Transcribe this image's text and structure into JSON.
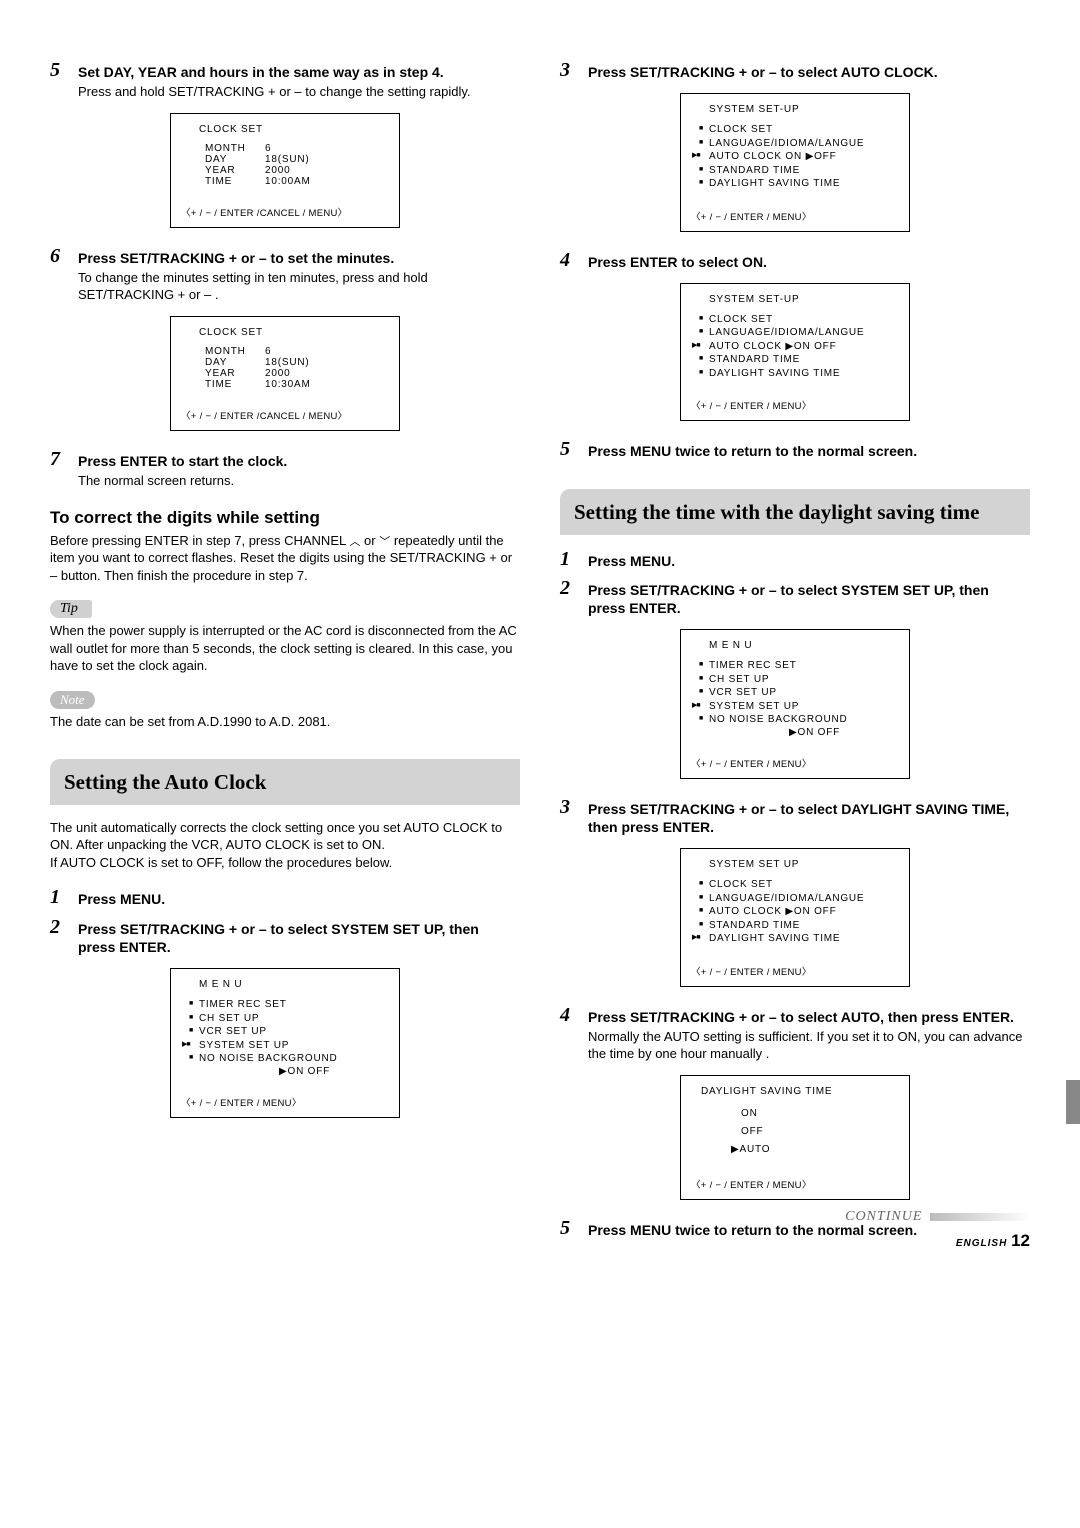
{
  "left": {
    "step5": {
      "title": "Set DAY, YEAR and hours in the same way as in step 4.",
      "text": "Press and hold SET/TRACKING + or – to change the setting rapidly."
    },
    "osd_clock1": {
      "title": "CLOCK  SET",
      "month_l": "MONTH",
      "month_v": "6",
      "day_l": "DAY",
      "day_v": "18(SUN)",
      "year_l": "YEAR",
      "year_v": "2000",
      "time_l": "TIME",
      "time_v": "10:00AM",
      "footer": "〈+ / − / ENTER /CANCEL / MENU〉"
    },
    "step6": {
      "title": "Press SET/TRACKING + or – to set the minutes.",
      "text": "To change the minutes setting in ten minutes, press and hold SET/TRACKING + or – ."
    },
    "osd_clock2": {
      "title": "CLOCK  SET",
      "month_l": "MONTH",
      "month_v": "6",
      "day_l": "DAY",
      "day_v": "18(SUN)",
      "year_l": "YEAR",
      "year_v": "2000",
      "time_l": "TIME",
      "time_v": "10:30AM",
      "footer": "〈+ / − / ENTER /CANCEL / MENU〉"
    },
    "step7": {
      "title": "Press ENTER to start the clock.",
      "text": "The normal screen returns."
    },
    "correct_heading": "To correct the digits while setting",
    "correct_text1": "Before pressing ENTER in step 7, press CHANNEL",
    "correct_text2": "or",
    "correct_text3": "repeatedly until the item you want to correct flashes. Reset the digits using the SET/TRACKING + or – button. Then finish the procedure in step 7.",
    "tip_label": "Tip",
    "tip_text": "When the power supply is interrupted or the AC cord is disconnected from the AC wall outlet for more than 5 seconds, the clock setting is cleared. In this case, you have to set the clock again.",
    "note_label": "Note",
    "note_text": "The date can be set from A.D.1990 to A.D. 2081.",
    "autoclock_heading": "Setting the Auto Clock",
    "autoclock_intro": "The unit automatically corrects the clock setting once you set AUTO CLOCK to ON. After unpacking the VCR, AUTO CLOCK is set to ON.\nIf AUTO CLOCK is set to OFF, follow the procedures below.",
    "ac_step1": "Press MENU.",
    "ac_step2": "Press SET/TRACKING + or – to select SYSTEM SET UP, then press ENTER.",
    "osd_menu1": {
      "title": "M  E  N  U",
      "i1": "TIMER REC SET",
      "i2": "CH SET UP",
      "i3": "VCR SET UP",
      "i4": "SYSTEM SET UP",
      "i5": "NO NOISE BACKGROUND",
      "onoff": "▶ON    OFF",
      "footer": "〈+ / − / ENTER / MENU〉"
    }
  },
  "right": {
    "step3": "Press SET/TRACKING + or – to select AUTO CLOCK.",
    "osd_sys1": {
      "title": "SYSTEM  SET-UP",
      "i1": "CLOCK SET",
      "i2": "LANGUAGE/IDIOMA/LANGUE",
      "i3": "AUTO CLOCK    ON   ▶OFF",
      "i4": "STANDARD TIME",
      "i5": "DAYLIGHT SAVING TIME",
      "footer": "〈+ / − / ENTER / MENU〉"
    },
    "step4": "Press ENTER to select ON.",
    "osd_sys2": {
      "title": "SYSTEM  SET-UP",
      "i1": "CLOCK SET",
      "i2": "LANGUAGE/IDIOMA/LANGUE",
      "i3": "AUTO CLOCK  ▶ON    OFF",
      "i4": "STANDARD TIME",
      "i5": "DAYLIGHT SAVING TIME",
      "footer": "〈+ / − / ENTER / MENU〉"
    },
    "step5": "Press MENU twice to return to the normal screen.",
    "dst_heading": "Setting the time with the daylight saving time",
    "d_step1": "Press MENU.",
    "d_step2": "Press SET/TRACKING + or – to select SYSTEM SET UP, then press ENTER.",
    "osd_menu2": {
      "title": "M  E  N  U",
      "i1": "TIMER REC SET",
      "i2": "CH SET UP",
      "i3": "VCR SET UP",
      "i4": "SYSTEM SET UP",
      "i5": "NO NOISE BACKGROUND",
      "onoff": "▶ON    OFF",
      "footer": "〈+ / − / ENTER / MENU〉"
    },
    "d_step3": "Press SET/TRACKING + or – to select DAYLIGHT SAVING TIME, then press ENTER.",
    "osd_sys3": {
      "title": "SYSTEM  SET UP",
      "i1": "CLOCK SET",
      "i2": "LANGUAGE/IDIOMA/LANGUE",
      "i3": "AUTO CLOCK  ▶ON    OFF",
      "i4": "STANDARD TIME",
      "i5": "DAYLIGHT SAVING TIME",
      "footer": "〈+ / − / ENTER / MENU〉"
    },
    "d_step4_title": "Press SET/TRACKING + or – to select AUTO, then press ENTER.",
    "d_step4_text": "Normally the AUTO setting is sufficient. If you set it to ON, you can advance the time by one hour manually .",
    "osd_dst": {
      "title": "DAYLIGHT  SAVING  TIME",
      "o1": "ON",
      "o2": "OFF",
      "o3": "▶AUTO",
      "footer": "〈+ / − / ENTER / MENU〉"
    },
    "d_step5": "Press MENU twice to return to the normal screen."
  },
  "footer": {
    "continue": "CONTINUE",
    "english": "ENGLISH",
    "page": "12"
  }
}
